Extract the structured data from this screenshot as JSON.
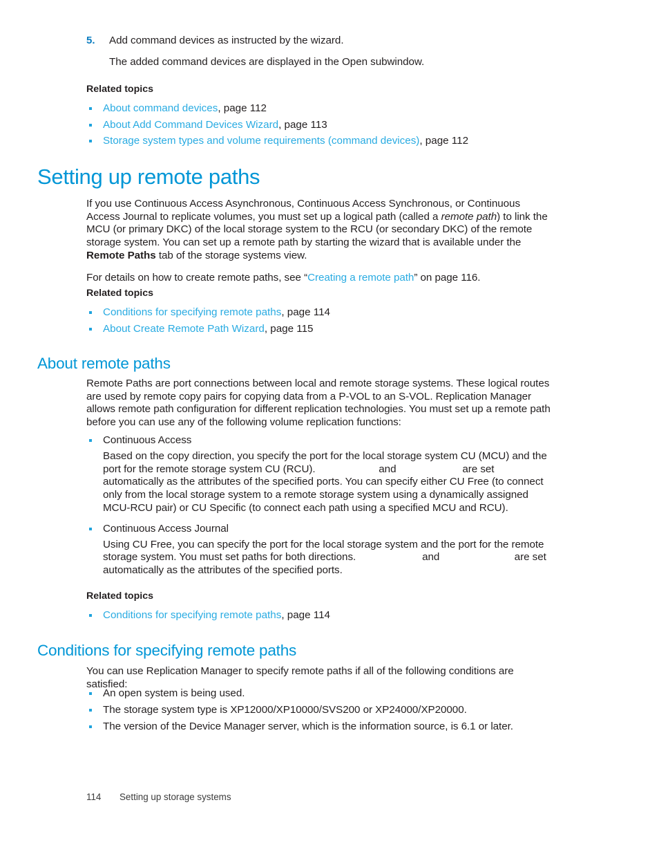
{
  "step": {
    "number": "5.",
    "text": "Add command devices as instructed by the wizard.",
    "result": "The added command devices are displayed in the Open subwindow."
  },
  "related_topics_label": "Related topics",
  "related_1": [
    {
      "link": "About command devices",
      "tail": ", page 112"
    },
    {
      "link": "About Add Command Devices Wizard",
      "tail": ", page 113"
    },
    {
      "link": "Storage system types and volume requirements (command devices)",
      "tail": ", page 112"
    }
  ],
  "section_setting_up": {
    "heading": "Setting up remote paths",
    "para1_a": "If you use Continuous Access Asynchronous, Continuous Access Synchronous, or Continuous Access Journal to replicate volumes, you must set up a logical path (called a ",
    "para1_em": "remote path",
    "para1_b": ") to link the MCU (or primary DKC) of the local storage system to the RCU (or secondary DKC) of the remote storage system. You can set up a remote path by starting the wizard that is available under the ",
    "para1_bold": "Remote Paths",
    "para1_c": " tab of the storage systems view.",
    "para2_a": "For details on how to create remote paths, see “",
    "para2_link": "Creating a remote path",
    "para2_b": "” on page 116.",
    "related": [
      {
        "link": "Conditions for specifying remote paths",
        "tail": ", page 114"
      },
      {
        "link": "About Create Remote Path Wizard",
        "tail": ", page 115"
      }
    ]
  },
  "section_about": {
    "heading": "About remote paths",
    "intro": "Remote Paths are port connections between local and remote storage systems. These logical routes are used by remote copy pairs for copying data from a P-VOL to an S-VOL. Replication Manager allows remote path configuration for different replication technologies. You must set up a remote path before you can use any of the following volume replication functions:",
    "items": [
      {
        "term": "Continuous Access",
        "desc_a": "Based on the copy direction, you specify the port for the local storage system CU (MCU) and the port for the remote storage system CU (RCU).",
        "ghost_1": "                     ",
        "desc_b": " and ",
        "ghost_2": "                     ",
        "desc_c": " are set automatically as the attributes of the specified ports. You can specify either CU Free (to connect only from the local storage system to a remote storage system using a dynamically assigned MCU-RCU pair) or CU Specific (to connect each path using a specified MCU and RCU)."
      },
      {
        "term": "Continuous Access Journal",
        "desc_a": "Using CU Free, you can specify the port for the local storage system and the port for the remote storage system. You must set paths for both directions.",
        "ghost_1": "                      ",
        "desc_b": " and ",
        "ghost_2": "                        ",
        "desc_c": " are set automatically as the attributes of the specified ports."
      }
    ],
    "related": [
      {
        "link": "Conditions for specifying remote paths",
        "tail": ", page 114"
      }
    ]
  },
  "section_conditions": {
    "heading": "Conditions for specifying remote paths",
    "intro": "You can use Replication Manager to specify remote paths if all of the following conditions are satisfied:",
    "bullets": [
      "An open system is being used.",
      "The storage system type is XP12000/XP10000/SVS200 or XP24000/XP20000.",
      "The version of the Device Manager server, which is the information source, is 6.1 or later."
    ]
  },
  "footer": {
    "page_number": "114",
    "chapter": "Setting up storage systems"
  },
  "colors": {
    "heading_blue": "#0096d6",
    "link_blue": "#29abe2",
    "bullet_blue": "#1fa3dd",
    "body_text": "#231f20"
  }
}
